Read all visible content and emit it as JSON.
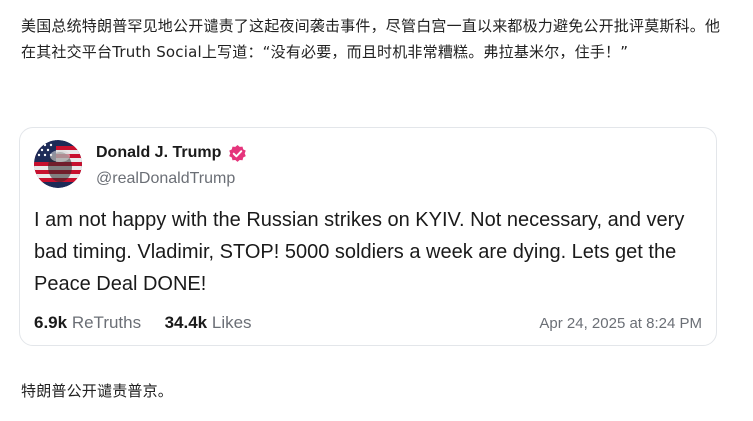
{
  "article": {
    "intro_text": "美国总统特朗普罕见地公开谴责了这起夜间袭击事件，尽管白宫一直以来都极力避免公开批评莫斯科。他在其社交平台Truth Social上写道：“没有必要，而且时机非常糟糕。弗拉基米尔，住手！”",
    "closing_text": "特朗普公开谴责普京。"
  },
  "post": {
    "author_name": "Donald J. Trump",
    "handle": "@realDonaldTrump",
    "text": "I am not happy with the Russian strikes on KYIV. Not necessary, and very bad timing. Vladimir, STOP! 5000 soldiers a week are dying. Lets get the Peace Deal DONE!",
    "retruths_count": "6.9k",
    "retruths_label": "ReTruths",
    "likes_count": "34.4k",
    "likes_label": "Likes",
    "timestamp": "Apr 24, 2025 at 8:24 PM",
    "verified_badge_color": "#e5357c",
    "avatar_icon": "flag-portrait-avatar"
  }
}
